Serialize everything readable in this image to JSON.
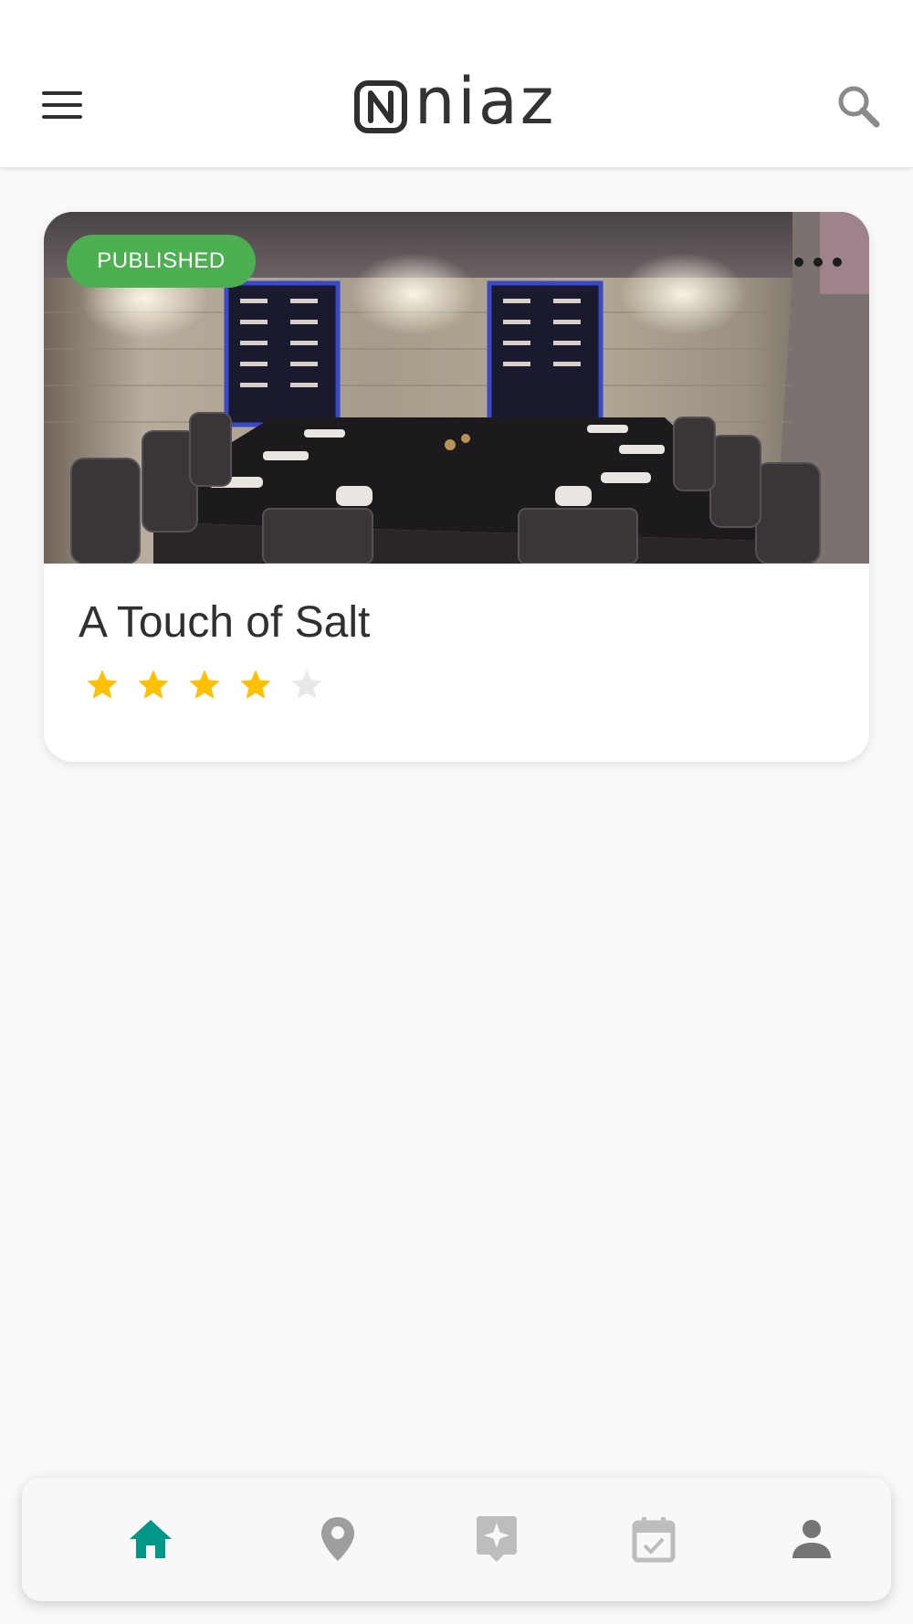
{
  "app": {
    "brand_name": "niaz",
    "icons": {
      "menu": "hamburger-menu-icon",
      "search": "search-icon",
      "more": "more-horizontal-icon"
    }
  },
  "listing": {
    "status_badge": "PUBLISHED",
    "title": "A Touch of Salt",
    "rating": 4,
    "rating_max": 5,
    "image_description_icon": "restaurant-photo"
  },
  "bottom_nav": {
    "items": [
      {
        "name": "home",
        "icon": "home-icon",
        "active": true
      },
      {
        "name": "location",
        "icon": "location-pin-icon",
        "active": false
      },
      {
        "name": "featured",
        "icon": "sparkle-badge-icon",
        "active": false
      },
      {
        "name": "calendar",
        "icon": "calendar-check-icon",
        "active": false
      },
      {
        "name": "profile",
        "icon": "person-icon",
        "active": false
      }
    ]
  },
  "colors": {
    "badge": "#4caf50",
    "star_filled": "#ffc107",
    "star_empty": "#e8e8e8",
    "nav_active": "#009688",
    "nav_inactive": "#9e9e9e"
  }
}
